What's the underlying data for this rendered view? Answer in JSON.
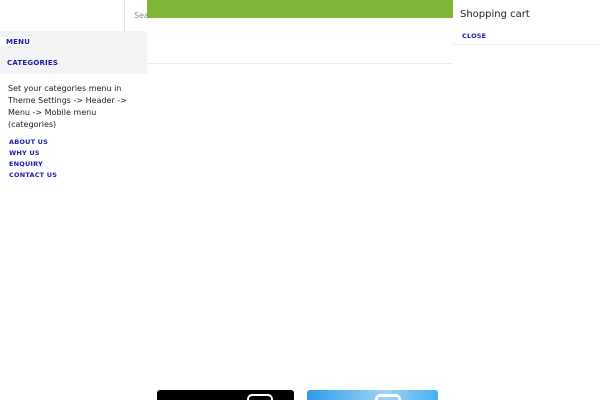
{
  "mobile_menu": {
    "search_placeholder": "Sea",
    "tabs": [
      {
        "label": "MENU",
        "active": true
      },
      {
        "label": "CATEGORIES",
        "active": false
      }
    ],
    "categories_hint": "Set your categories menu in Theme Settings -> Header -> Menu -> Mobile menu (categories)",
    "links": [
      "ABOUT US",
      "WHY US",
      "ENQUIRY",
      "CONTACT US"
    ]
  },
  "cart": {
    "title": "Shopping cart",
    "close_label": "CLOSE"
  },
  "colors": {
    "top_bar": "#80b737",
    "link": "#1a1aa6",
    "tab_strip": "#f3f3f3"
  }
}
